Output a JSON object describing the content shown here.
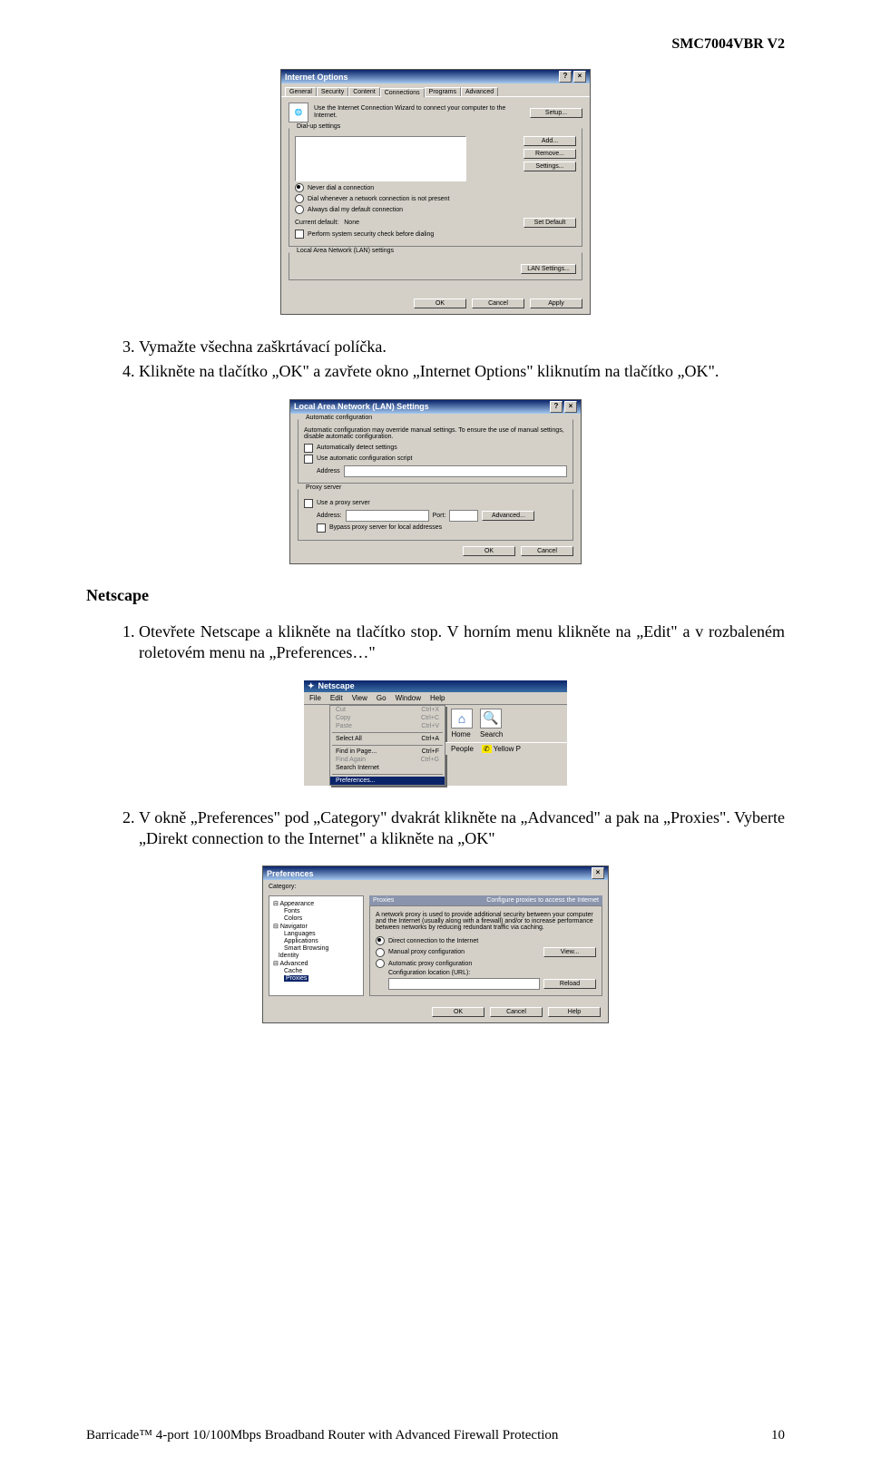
{
  "header": {
    "model": "SMC7004VBR V2"
  },
  "dlg_io": {
    "title": "Internet Options",
    "tabs": [
      "General",
      "Security",
      "Content",
      "Connections",
      "Programs",
      "Advanced"
    ],
    "wizard_text": "Use the Internet Connection Wizard to connect your computer to the Internet.",
    "setup_btn": "Setup...",
    "dialup_label": "Dial-up settings",
    "add_btn": "Add...",
    "remove_btn": "Remove...",
    "settings_btn": "Settings...",
    "radio1": "Never dial a connection",
    "radio2": "Dial whenever a network connection is not present",
    "radio3": "Always dial my default connection",
    "current_label": "Current default:",
    "current_value": "None",
    "setdefault_btn": "Set Default",
    "syscheck": "Perform system security check before dialing",
    "lan_label": "Local Area Network (LAN) settings",
    "lan_btn": "LAN Settings...",
    "ok": "OK",
    "cancel": "Cancel",
    "apply": "Apply"
  },
  "steps1": {
    "s3": "Vymažte všechna zaškrtávací políčka.",
    "s4": "Klikněte na tlačítko „OK\" a zavřete okno „Internet Options\" kliknutím na tlačítko „OK\"."
  },
  "dlg_lan": {
    "title": "Local Area Network (LAN) Settings",
    "auto_label": "Automatic configuration",
    "auto_desc": "Automatic configuration may override manual settings. To ensure the use of manual settings, disable automatic configuration.",
    "auto_detect": "Automatically detect settings",
    "use_script": "Use automatic configuration script",
    "addr_label": "Address",
    "proxy_label": "Proxy server",
    "use_proxy": "Use a proxy server",
    "paddr": "Address:",
    "pport": "Port:",
    "adv": "Advanced...",
    "bypass": "Bypass proxy server for local addresses",
    "ok": "OK",
    "cancel": "Cancel"
  },
  "netscape_title": "Netscape",
  "steps2": {
    "s1": "Otevřete Netscape a klikněte na tlačítko stop. V horním menu klikněte na „Edit\" a v rozbaleném roletovém menu na „Preferences…\""
  },
  "ns": {
    "app": "Netscape",
    "menus": [
      "File",
      "Edit",
      "View",
      "Go",
      "Window",
      "Help"
    ],
    "items": [
      {
        "l": "Cut",
        "r": "Ctrl+X",
        "gray": true
      },
      {
        "l": "Copy",
        "r": "Ctrl+C",
        "gray": true
      },
      {
        "l": "Paste",
        "r": "Ctrl+V",
        "gray": true
      }
    ],
    "items2": [
      {
        "l": "Select All",
        "r": "Ctrl+A"
      }
    ],
    "items3": [
      {
        "l": "Find in Page...",
        "r": "Ctrl+F"
      },
      {
        "l": "Find Again",
        "r": "Ctrl+G",
        "gray": true
      },
      {
        "l": "Search Internet",
        "r": ""
      }
    ],
    "pref": "Preferences...",
    "toolbar_icons": [
      {
        "name": "home-icon",
        "label": "Home",
        "glyph": "⌂"
      },
      {
        "name": "search-icon",
        "label": "Search",
        "glyph": "🔍"
      }
    ],
    "people": "People",
    "yellow": "Yellow P"
  },
  "steps3": {
    "s2": "V okně „Preferences\" pod „Category\" dvakrát klikněte na „Advanced\"  a pak na „Proxies\". Vyberte „Direkt connection to the Internet\" a klikněte na „OK\""
  },
  "pref": {
    "title": "Preferences",
    "category": "Category:",
    "tree": {
      "appearance": "Appearance",
      "fonts": "Fonts",
      "colors": "Colors",
      "navigator": "Navigator",
      "languages": "Languages",
      "applications": "Applications",
      "smart": "Smart Browsing",
      "identity": "Identity",
      "advanced": "Advanced",
      "cache": "Cache",
      "proxies": "Proxies"
    },
    "panel_title": "Proxies",
    "panel_sub": "Configure proxies to access the Internet",
    "desc": "A network proxy is used to provide additional security between your computer and the Internet (usually along with a firewall) and/or to increase performance between networks by reducing redundant traffic via caching.",
    "r1": "Direct connection to the Internet",
    "r2": "Manual proxy configuration",
    "view": "View...",
    "r3": "Automatic proxy configuration",
    "cfg": "Configuration location (URL):",
    "reload": "Reload",
    "ok": "OK",
    "cancel": "Cancel",
    "help": "Help"
  },
  "footer": {
    "left": "Barricade™ 4-port 10/100Mbps Broadband Router with Advanced Firewall Protection",
    "page": "10"
  }
}
